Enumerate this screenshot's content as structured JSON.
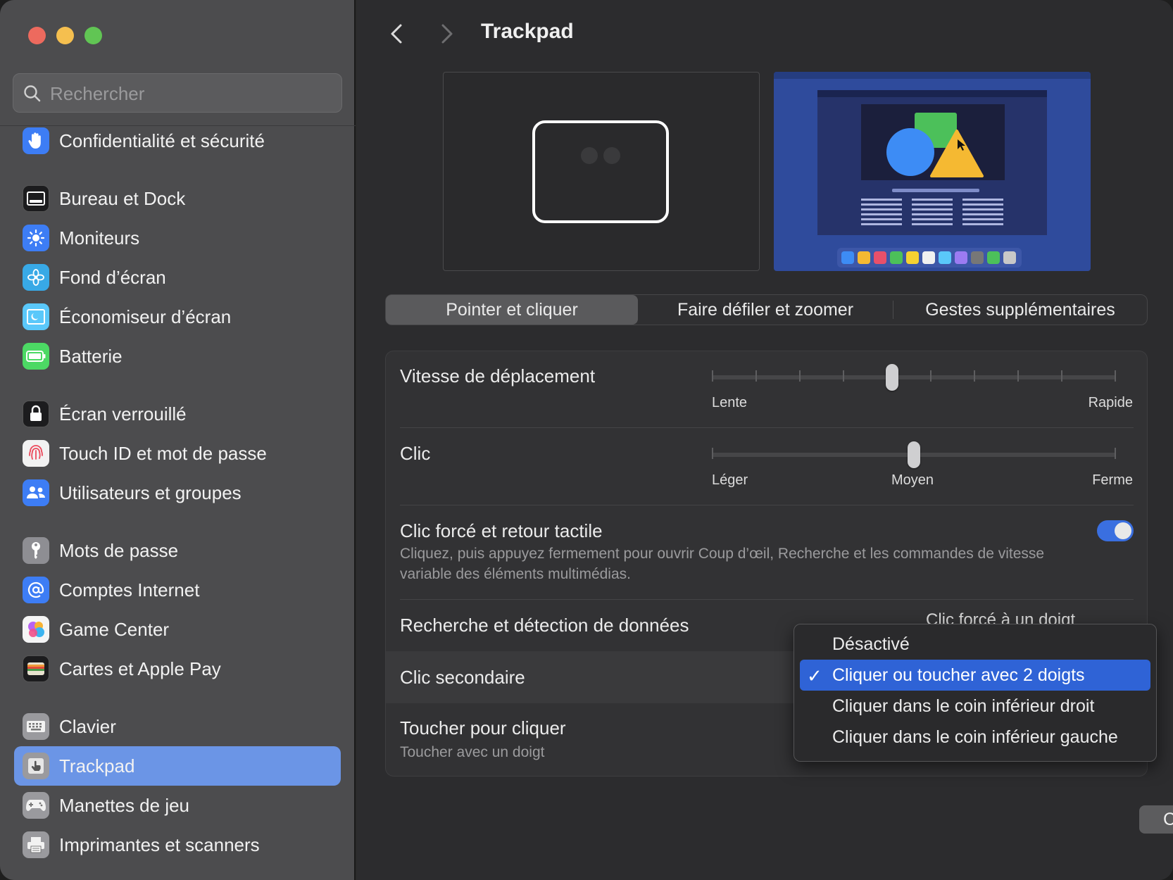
{
  "window": {
    "title": "Trackpad"
  },
  "sidebar": {
    "search_placeholder": "Rechercher",
    "items": [
      {
        "label": "Confidentialité et sécurité",
        "icon": "hand-icon"
      },
      {
        "label": "Bureau et Dock",
        "icon": "dock-icon"
      },
      {
        "label": "Moniteurs",
        "icon": "sun-icon"
      },
      {
        "label": "Fond d’écran",
        "icon": "flower-icon"
      },
      {
        "label": "Économiseur d’écran",
        "icon": "screensaver-icon"
      },
      {
        "label": "Batterie",
        "icon": "battery-icon"
      },
      {
        "label": "Écran verrouillé",
        "icon": "lock-icon"
      },
      {
        "label": "Touch ID et mot de passe",
        "icon": "fingerprint-icon"
      },
      {
        "label": "Utilisateurs et groupes",
        "icon": "users-icon"
      },
      {
        "label": "Mots de passe",
        "icon": "key-icon"
      },
      {
        "label": "Comptes Internet",
        "icon": "at-icon"
      },
      {
        "label": "Game Center",
        "icon": "game-center-icon"
      },
      {
        "label": "Cartes et Apple Pay",
        "icon": "wallet-icon"
      },
      {
        "label": "Clavier",
        "icon": "keyboard-icon"
      },
      {
        "label": "Trackpad",
        "icon": "trackpad-icon",
        "selected": true
      },
      {
        "label": "Manettes de jeu",
        "icon": "gamepad-icon"
      },
      {
        "label": "Imprimantes et scanners",
        "icon": "printer-icon"
      }
    ]
  },
  "tabs": [
    {
      "label": "Pointer et cliquer",
      "selected": true
    },
    {
      "label": "Faire défiler et zoomer"
    },
    {
      "label": "Gestes supplémentaires"
    }
  ],
  "settings": {
    "speed": {
      "label": "Vitesse de déplacement",
      "min_label": "Lente",
      "max_label": "Rapide",
      "value_step": 4,
      "steps": 10
    },
    "click": {
      "label": "Clic",
      "labels": [
        "Léger",
        "Moyen",
        "Ferme"
      ],
      "value_step": 1,
      "steps": 2
    },
    "force_click": {
      "label": "Clic forcé et retour tactile",
      "description": "Cliquez, puis appuyez fermement pour ouvrir Coup d’œil, Recherche et les commandes de vitesse variable des éléments multimédias.",
      "enabled": true
    },
    "lookup": {
      "label": "Recherche et détection de données",
      "value": "Clic forcé à un doigt"
    },
    "secondary_click": {
      "label": "Clic secondaire"
    },
    "tap_to_click": {
      "label": "Toucher pour cliquer",
      "description": "Toucher avec un doigt"
    }
  },
  "dropdown_menu": {
    "items": [
      {
        "label": "Désactivé"
      },
      {
        "label": "Cliquer ou toucher avec 2 doigts",
        "checked": true
      },
      {
        "label": "Cliquer dans le coin inférieur droit"
      },
      {
        "label": "Cliquer dans le coin inférieur gauche"
      }
    ],
    "check_glyph": "✓"
  },
  "footer": {
    "configure_button": "Configurer un trackpad Bluetooth…",
    "help_button": "?"
  },
  "colors": {
    "accent": "#6b95e6",
    "selection": "#2f63d6",
    "toggle_on": "#3a6fe0"
  }
}
